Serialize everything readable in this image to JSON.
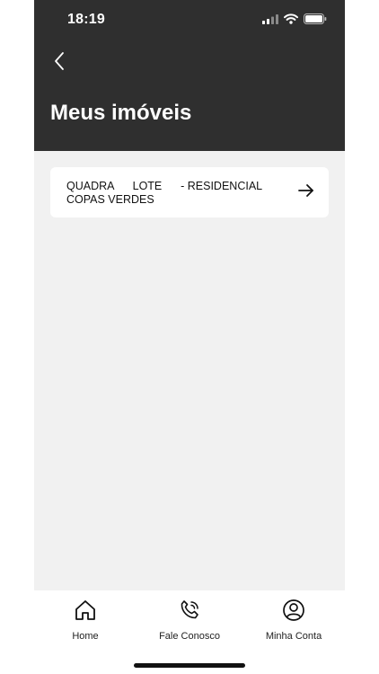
{
  "status_bar": {
    "time": "18:19"
  },
  "header": {
    "title": "Meus imóveis",
    "background": "#2f2f2f"
  },
  "properties": [
    {
      "name": "QUADRA      LOTE      - RESIDENCIAL\nCOPAS VERDES"
    }
  ],
  "tabbar": {
    "items": [
      {
        "label": "Home",
        "icon": "house-icon"
      },
      {
        "label": "Fale Conosco",
        "icon": "phone-icon"
      },
      {
        "label": "Minha Conta",
        "icon": "user-circle-icon"
      }
    ]
  },
  "colors": {
    "content_background": "#f1f1f1",
    "card_background": "#ffffff",
    "text_dark": "#111111"
  }
}
